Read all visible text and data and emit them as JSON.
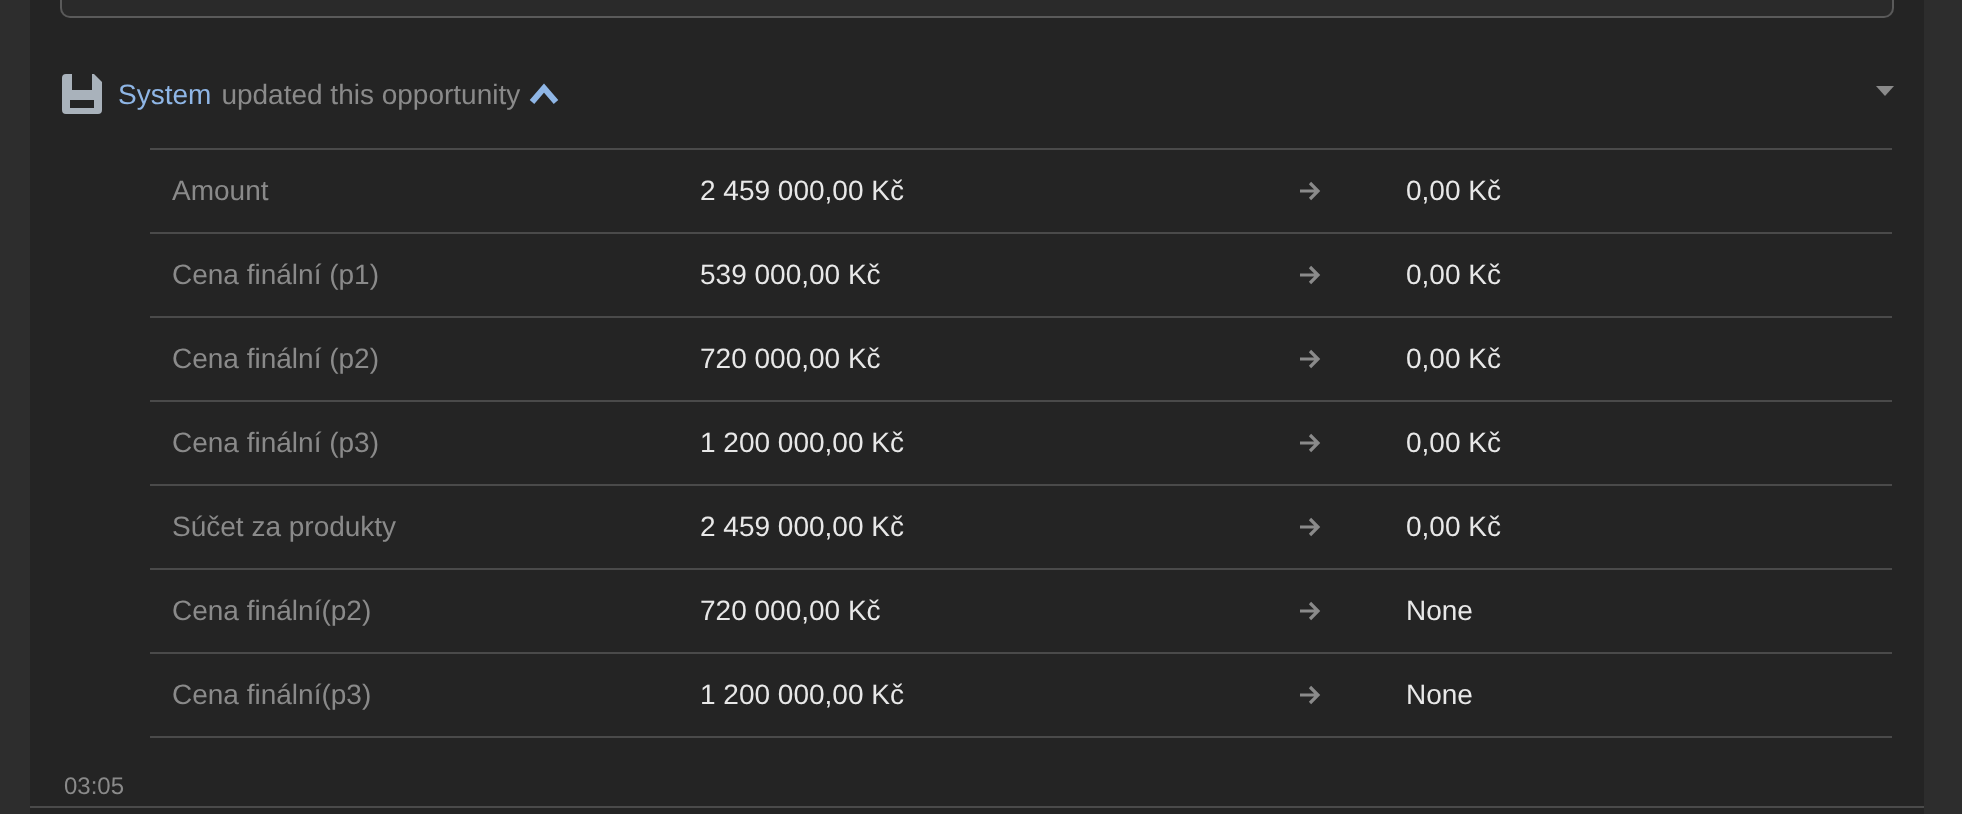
{
  "event": {
    "actor": "System",
    "action": "updated this opportunity",
    "expanded": true,
    "changes": [
      {
        "field": "Amount",
        "old": "2 459 000,00 Kč",
        "new": "0,00 Kč"
      },
      {
        "field": "Cena finální (p1)",
        "old": "539 000,00 Kč",
        "new": "0,00 Kč"
      },
      {
        "field": "Cena finální (p2)",
        "old": "720 000,00 Kč",
        "new": "0,00 Kč"
      },
      {
        "field": "Cena finální (p3)",
        "old": "1 200 000,00 Kč",
        "new": "0,00 Kč"
      },
      {
        "field": "Súčet za produkty",
        "old": "2 459 000,00 Kč",
        "new": "0,00 Kč"
      },
      {
        "field": "Cena finální(p2)",
        "old": "720 000,00 Kč",
        "new": "None"
      },
      {
        "field": "Cena finální(p3)",
        "old": "1 200 000,00 Kč",
        "new": "None"
      }
    ],
    "time": "03:05"
  }
}
